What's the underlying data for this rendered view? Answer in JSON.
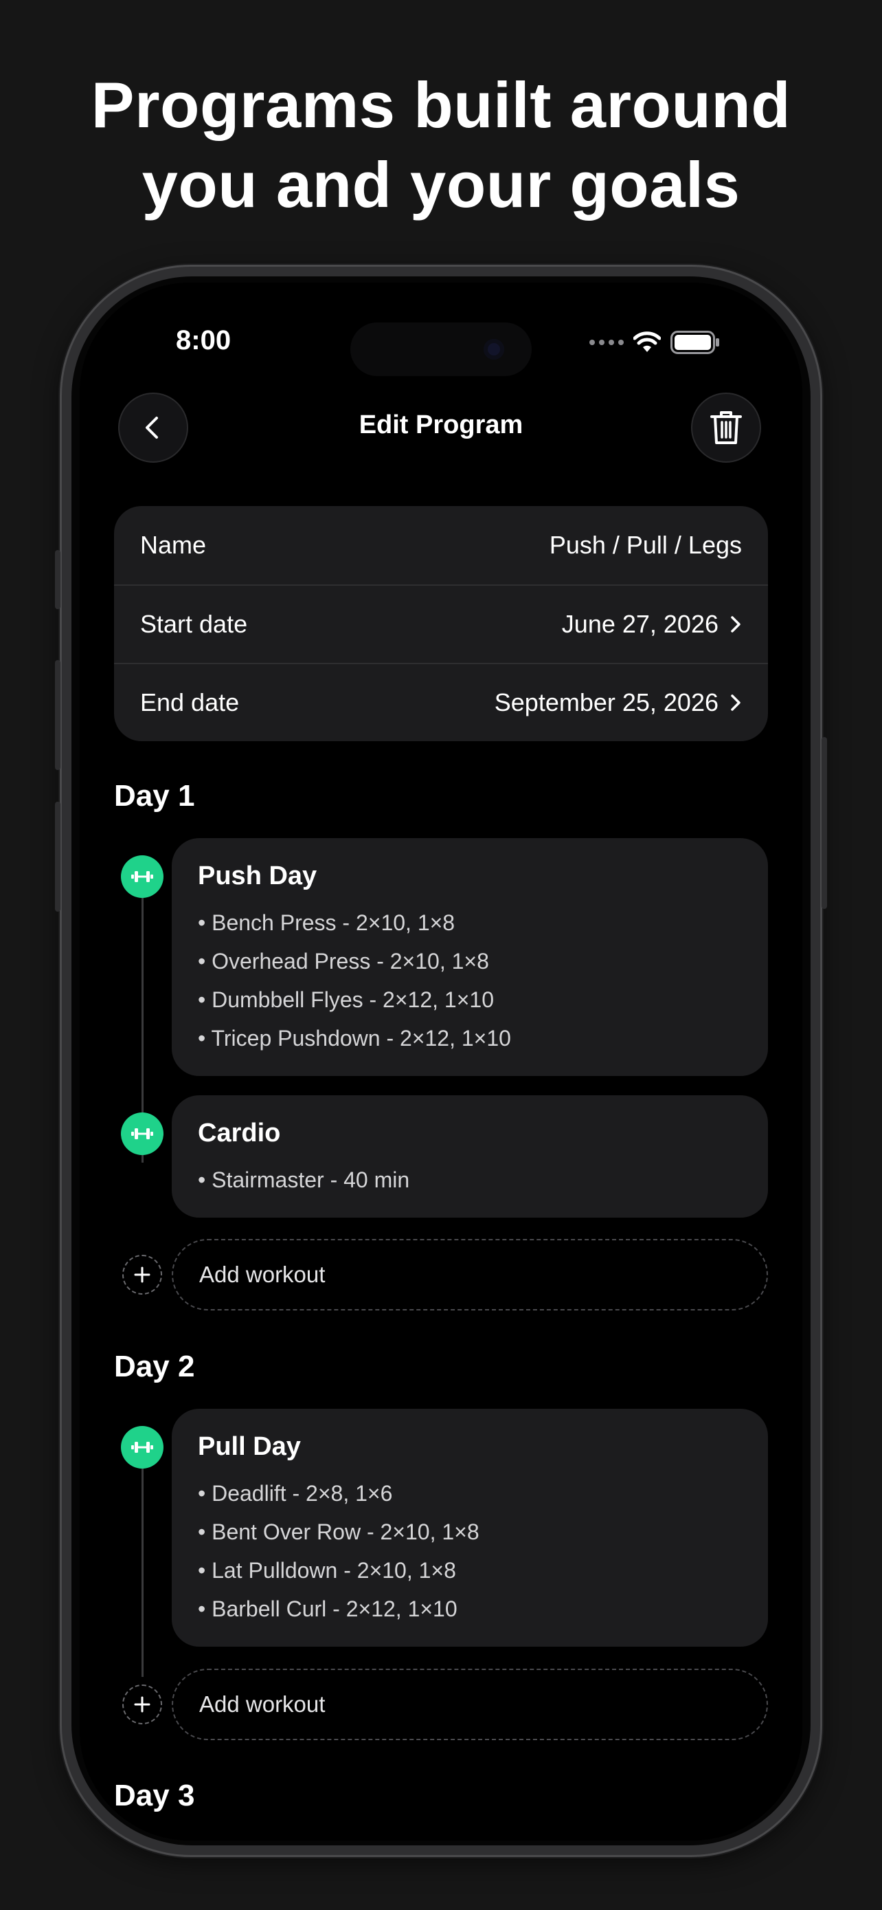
{
  "headline": {
    "line1": "Programs built around",
    "line2": "you and your goals"
  },
  "status_bar": {
    "time": "8:00"
  },
  "nav": {
    "title": "Edit Program",
    "back_icon": "chevron-left-icon",
    "delete_icon": "trash-icon"
  },
  "program": {
    "name_label": "Name",
    "name_value": "Push / Pull / Legs",
    "start_label": "Start date",
    "start_value": "June 27, 2026",
    "end_label": "End date",
    "end_value": "September 25, 2026"
  },
  "days": [
    {
      "title": "Day 1",
      "workouts": [
        {
          "title": "Push Day",
          "exercises": [
            "• Bench Press - 2×10, 1×8",
            "• Overhead Press - 2×10, 1×8",
            "• Dumbbell Flyes - 2×12, 1×10",
            "• Tricep Pushdown - 2×12, 1×10"
          ]
        },
        {
          "title": "Cardio",
          "exercises": [
            "• Stairmaster - 40 min"
          ]
        }
      ],
      "add_label": "Add workout"
    },
    {
      "title": "Day 2",
      "workouts": [
        {
          "title": "Pull Day",
          "exercises": [
            "• Deadlift - 2×8, 1×6",
            "• Bent Over Row - 2×10, 1×8",
            "• Lat Pulldown - 2×10, 1×8",
            "• Barbell Curl - 2×12, 1×10"
          ]
        }
      ],
      "add_label": "Add workout"
    },
    {
      "title": "Day 3"
    }
  ],
  "colors": {
    "accent": "#1fd28a",
    "card": "#1c1c1e",
    "background": "#000000"
  }
}
